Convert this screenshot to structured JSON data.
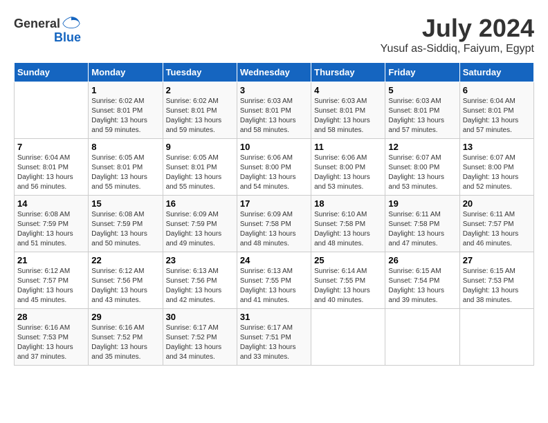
{
  "header": {
    "logo_general": "General",
    "logo_blue": "Blue",
    "month_year": "July 2024",
    "location": "Yusuf as-Siddiq, Faiyum, Egypt"
  },
  "days_of_week": [
    "Sunday",
    "Monday",
    "Tuesday",
    "Wednesday",
    "Thursday",
    "Friday",
    "Saturday"
  ],
  "weeks": [
    [
      {
        "day": "",
        "sunrise": "",
        "sunset": "",
        "daylight": ""
      },
      {
        "day": "1",
        "sunrise": "Sunrise: 6:02 AM",
        "sunset": "Sunset: 8:01 PM",
        "daylight": "Daylight: 13 hours and 59 minutes."
      },
      {
        "day": "2",
        "sunrise": "Sunrise: 6:02 AM",
        "sunset": "Sunset: 8:01 PM",
        "daylight": "Daylight: 13 hours and 59 minutes."
      },
      {
        "day": "3",
        "sunrise": "Sunrise: 6:03 AM",
        "sunset": "Sunset: 8:01 PM",
        "daylight": "Daylight: 13 hours and 58 minutes."
      },
      {
        "day": "4",
        "sunrise": "Sunrise: 6:03 AM",
        "sunset": "Sunset: 8:01 PM",
        "daylight": "Daylight: 13 hours and 58 minutes."
      },
      {
        "day": "5",
        "sunrise": "Sunrise: 6:03 AM",
        "sunset": "Sunset: 8:01 PM",
        "daylight": "Daylight: 13 hours and 57 minutes."
      },
      {
        "day": "6",
        "sunrise": "Sunrise: 6:04 AM",
        "sunset": "Sunset: 8:01 PM",
        "daylight": "Daylight: 13 hours and 57 minutes."
      }
    ],
    [
      {
        "day": "7",
        "sunrise": "Sunrise: 6:04 AM",
        "sunset": "Sunset: 8:01 PM",
        "daylight": "Daylight: 13 hours and 56 minutes."
      },
      {
        "day": "8",
        "sunrise": "Sunrise: 6:05 AM",
        "sunset": "Sunset: 8:01 PM",
        "daylight": "Daylight: 13 hours and 55 minutes."
      },
      {
        "day": "9",
        "sunrise": "Sunrise: 6:05 AM",
        "sunset": "Sunset: 8:01 PM",
        "daylight": "Daylight: 13 hours and 55 minutes."
      },
      {
        "day": "10",
        "sunrise": "Sunrise: 6:06 AM",
        "sunset": "Sunset: 8:00 PM",
        "daylight": "Daylight: 13 hours and 54 minutes."
      },
      {
        "day": "11",
        "sunrise": "Sunrise: 6:06 AM",
        "sunset": "Sunset: 8:00 PM",
        "daylight": "Daylight: 13 hours and 53 minutes."
      },
      {
        "day": "12",
        "sunrise": "Sunrise: 6:07 AM",
        "sunset": "Sunset: 8:00 PM",
        "daylight": "Daylight: 13 hours and 53 minutes."
      },
      {
        "day": "13",
        "sunrise": "Sunrise: 6:07 AM",
        "sunset": "Sunset: 8:00 PM",
        "daylight": "Daylight: 13 hours and 52 minutes."
      }
    ],
    [
      {
        "day": "14",
        "sunrise": "Sunrise: 6:08 AM",
        "sunset": "Sunset: 7:59 PM",
        "daylight": "Daylight: 13 hours and 51 minutes."
      },
      {
        "day": "15",
        "sunrise": "Sunrise: 6:08 AM",
        "sunset": "Sunset: 7:59 PM",
        "daylight": "Daylight: 13 hours and 50 minutes."
      },
      {
        "day": "16",
        "sunrise": "Sunrise: 6:09 AM",
        "sunset": "Sunset: 7:59 PM",
        "daylight": "Daylight: 13 hours and 49 minutes."
      },
      {
        "day": "17",
        "sunrise": "Sunrise: 6:09 AM",
        "sunset": "Sunset: 7:58 PM",
        "daylight": "Daylight: 13 hours and 48 minutes."
      },
      {
        "day": "18",
        "sunrise": "Sunrise: 6:10 AM",
        "sunset": "Sunset: 7:58 PM",
        "daylight": "Daylight: 13 hours and 48 minutes."
      },
      {
        "day": "19",
        "sunrise": "Sunrise: 6:11 AM",
        "sunset": "Sunset: 7:58 PM",
        "daylight": "Daylight: 13 hours and 47 minutes."
      },
      {
        "day": "20",
        "sunrise": "Sunrise: 6:11 AM",
        "sunset": "Sunset: 7:57 PM",
        "daylight": "Daylight: 13 hours and 46 minutes."
      }
    ],
    [
      {
        "day": "21",
        "sunrise": "Sunrise: 6:12 AM",
        "sunset": "Sunset: 7:57 PM",
        "daylight": "Daylight: 13 hours and 45 minutes."
      },
      {
        "day": "22",
        "sunrise": "Sunrise: 6:12 AM",
        "sunset": "Sunset: 7:56 PM",
        "daylight": "Daylight: 13 hours and 43 minutes."
      },
      {
        "day": "23",
        "sunrise": "Sunrise: 6:13 AM",
        "sunset": "Sunset: 7:56 PM",
        "daylight": "Daylight: 13 hours and 42 minutes."
      },
      {
        "day": "24",
        "sunrise": "Sunrise: 6:13 AM",
        "sunset": "Sunset: 7:55 PM",
        "daylight": "Daylight: 13 hours and 41 minutes."
      },
      {
        "day": "25",
        "sunrise": "Sunrise: 6:14 AM",
        "sunset": "Sunset: 7:55 PM",
        "daylight": "Daylight: 13 hours and 40 minutes."
      },
      {
        "day": "26",
        "sunrise": "Sunrise: 6:15 AM",
        "sunset": "Sunset: 7:54 PM",
        "daylight": "Daylight: 13 hours and 39 minutes."
      },
      {
        "day": "27",
        "sunrise": "Sunrise: 6:15 AM",
        "sunset": "Sunset: 7:53 PM",
        "daylight": "Daylight: 13 hours and 38 minutes."
      }
    ],
    [
      {
        "day": "28",
        "sunrise": "Sunrise: 6:16 AM",
        "sunset": "Sunset: 7:53 PM",
        "daylight": "Daylight: 13 hours and 37 minutes."
      },
      {
        "day": "29",
        "sunrise": "Sunrise: 6:16 AM",
        "sunset": "Sunset: 7:52 PM",
        "daylight": "Daylight: 13 hours and 35 minutes."
      },
      {
        "day": "30",
        "sunrise": "Sunrise: 6:17 AM",
        "sunset": "Sunset: 7:52 PM",
        "daylight": "Daylight: 13 hours and 34 minutes."
      },
      {
        "day": "31",
        "sunrise": "Sunrise: 6:17 AM",
        "sunset": "Sunset: 7:51 PM",
        "daylight": "Daylight: 13 hours and 33 minutes."
      },
      {
        "day": "",
        "sunrise": "",
        "sunset": "",
        "daylight": ""
      },
      {
        "day": "",
        "sunrise": "",
        "sunset": "",
        "daylight": ""
      },
      {
        "day": "",
        "sunrise": "",
        "sunset": "",
        "daylight": ""
      }
    ]
  ]
}
